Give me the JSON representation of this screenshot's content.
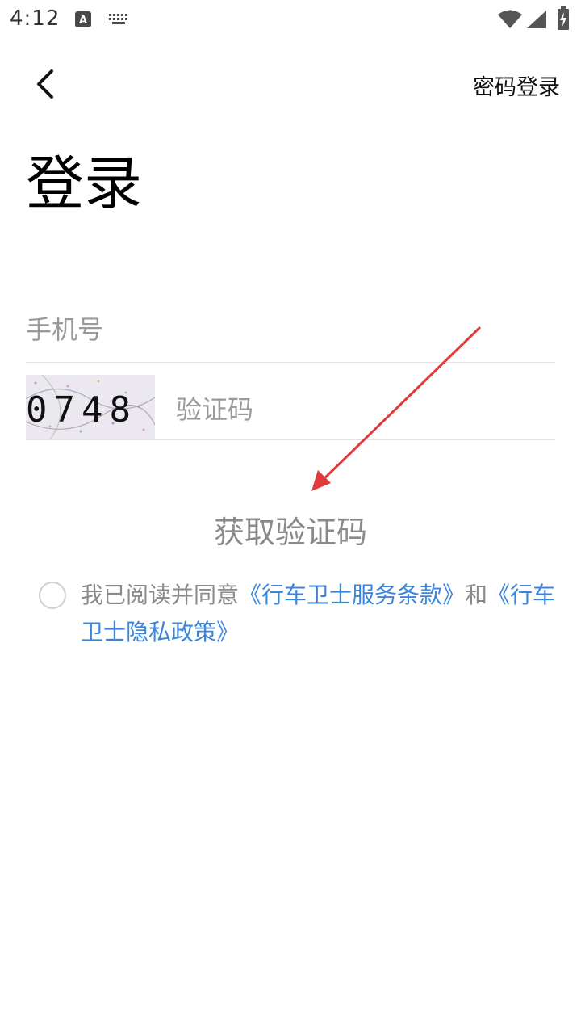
{
  "status_bar": {
    "time": "4:12",
    "icons": [
      "a-notification-icon",
      "keyboard-icon",
      "wifi-icon",
      "cell-signal-icon",
      "battery-charging-icon"
    ]
  },
  "top_bar": {
    "back_icon": "chevron-left-icon",
    "password_login": "密码登录"
  },
  "title": "登录",
  "form": {
    "phone_placeholder": "手机号",
    "captcha_text": "0748",
    "code_placeholder": "验证码",
    "get_code": "获取验证码"
  },
  "agreement": {
    "prefix": "我已阅读并同意",
    "terms_link": "《行车卫士服务条款》",
    "middle": "和",
    "privacy_link": "《行车卫士隐私政策》",
    "checked": false
  },
  "annotation": {
    "arrow_color": "#e03a3a"
  },
  "colors": {
    "link": "#3b86dd",
    "placeholder": "#9a9a9a",
    "divider": "#e4e4e4"
  }
}
